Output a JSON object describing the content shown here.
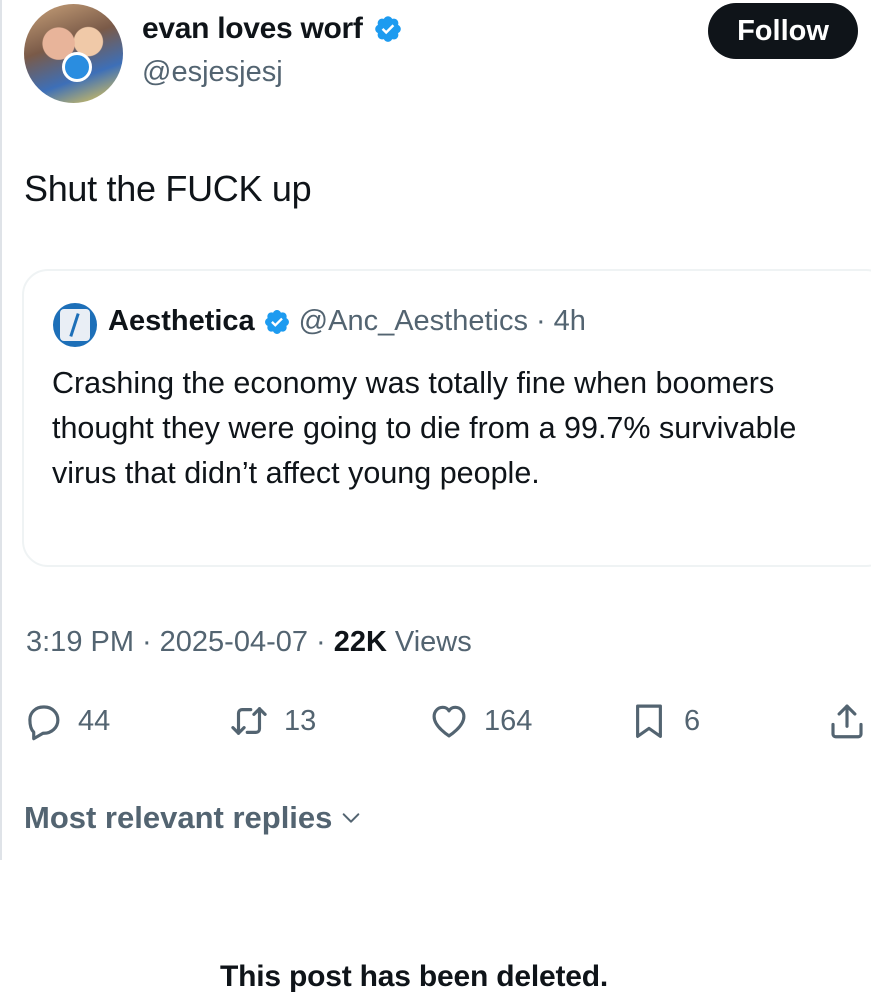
{
  "author": {
    "display_name": "evan loves worf",
    "handle": "@esjesjesj",
    "verified": true,
    "follow_label": "Follow"
  },
  "tweet": {
    "text": "Shut the FUCK up"
  },
  "quoted_tweet": {
    "display_name": "Aesthetica",
    "handle": "@Anc_Aesthetics",
    "separator": "·",
    "time": "4h",
    "text": "Crashing the economy was totally fine when boomers thought they were going to die from a 99.7% survivable virus that didn’t affect young people."
  },
  "meta": {
    "time": "3:19 PM",
    "date": "2025-04-07",
    "separator": "·",
    "views_count": "22K",
    "views_label": "Views"
  },
  "actions": {
    "replies": "44",
    "reposts": "13",
    "likes": "164",
    "bookmarks": "6"
  },
  "replies_sort": {
    "label": "Most relevant replies"
  },
  "deleted_notice": "This post has been deleted.",
  "colors": {
    "verified_blue": "#1d9bf0",
    "text_primary": "#0f1419",
    "text_secondary": "#536471",
    "follow_bg": "#0f1419"
  }
}
